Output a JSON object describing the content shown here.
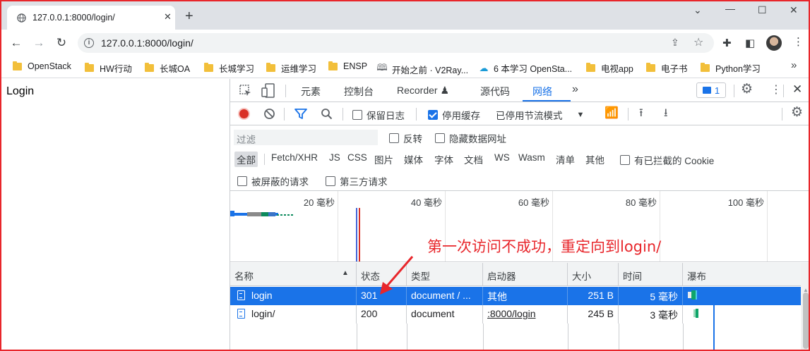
{
  "tab": {
    "title": "127.0.0.1:8000/login/",
    "close": "✕"
  },
  "window": {
    "newtab": "+",
    "minimize": "⌄",
    "restore": "—",
    "maximize": "☐",
    "close": "✕"
  },
  "address": {
    "url": "127.0.0.1:8000/login/"
  },
  "bookmarks": [
    {
      "label": "OpenStack",
      "icon": "folder-icon"
    },
    {
      "label": "HW行动",
      "icon": "folder-icon"
    },
    {
      "label": "长城OA",
      "icon": "folder-icon"
    },
    {
      "label": "长城学习",
      "icon": "folder-icon"
    },
    {
      "label": "运维学习",
      "icon": "folder-icon"
    },
    {
      "label": "ENSP",
      "icon": "folder-icon"
    },
    {
      "label": "开始之前 · V2Ray...",
      "icon": "book-icon"
    },
    {
      "label": "6 本学习 OpenSta...",
      "icon": "cloud-icon"
    },
    {
      "label": "电视app",
      "icon": "folder-icon"
    },
    {
      "label": "电子书",
      "icon": "folder-icon"
    },
    {
      "label": "Python学习",
      "icon": "folder-icon"
    }
  ],
  "page": {
    "text": "Login"
  },
  "devtools": {
    "tabs": [
      "元素",
      "控制台",
      "Recorder ♟",
      "源代码",
      "网络"
    ],
    "active_tab": "网络",
    "more": "»",
    "message_count": "1",
    "toolbar": {
      "preserve_log": "保留日志",
      "disable_cache": "停用缓存",
      "throttle": "已停用节流模式"
    },
    "filter": {
      "placeholder": "过滤",
      "invert": "反转",
      "hide_data_urls": "隐藏数据网址"
    },
    "types": [
      "全部",
      "Fetch/XHR",
      "JS",
      "CSS",
      "图片",
      "媒体",
      "字体",
      "文档",
      "WS",
      "Wasm",
      "清单",
      "其他"
    ],
    "blocked_cookies": "有已拦截的 Cookie",
    "blocked_requests": "被屏蔽的请求",
    "third_party": "第三方请求",
    "overview_labels": [
      "20 毫秒",
      "40 毫秒",
      "60 毫秒",
      "80 毫秒",
      "100 毫秒"
    ],
    "columns": [
      "名称",
      "状态",
      "类型",
      "启动器",
      "大小",
      "时间",
      "瀑布"
    ],
    "rows": [
      {
        "name": "login",
        "status": "301",
        "type": "document / ...",
        "initiator": "其他",
        "size": "251 B",
        "time": "5 毫秒",
        "selected": true
      },
      {
        "name": "login/",
        "status": "200",
        "type": "document",
        "initiator": ":8000/login",
        "size": "245 B",
        "time": "3 毫秒",
        "selected": false
      }
    ]
  },
  "annotation": {
    "text": "第一次访问不成功，重定向到login/",
    "color": "#e8262b"
  },
  "colors": {
    "accent": "#1a73e8",
    "record": "#d93025",
    "annotation": "#e8262b"
  }
}
